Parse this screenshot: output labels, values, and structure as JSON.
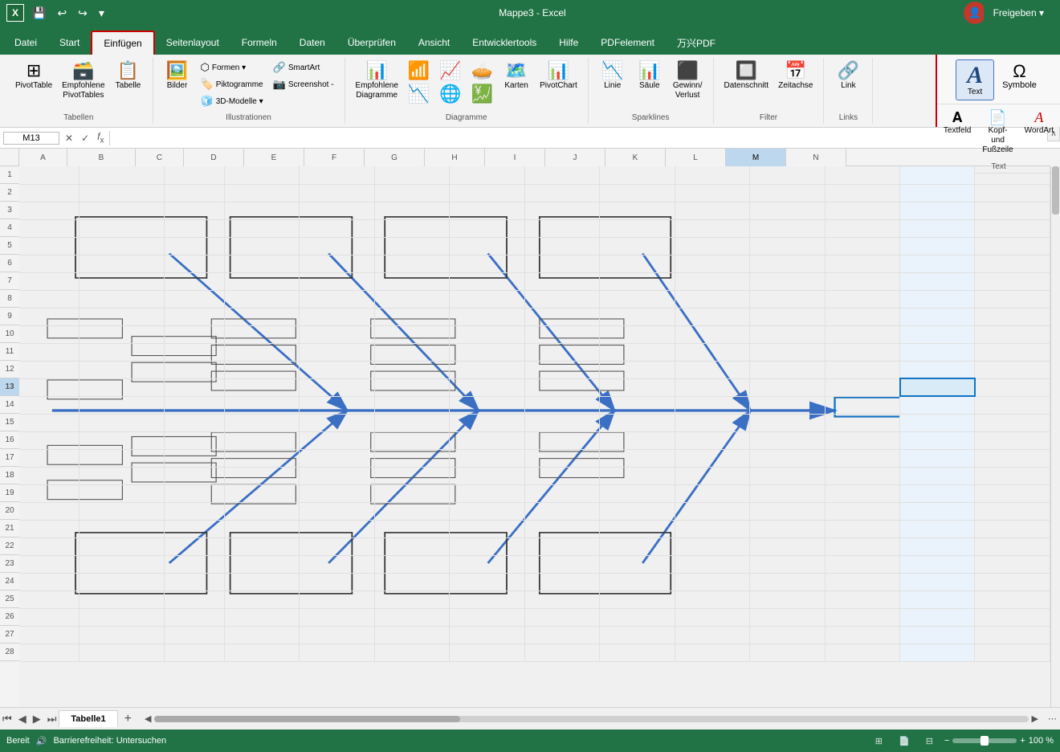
{
  "titlebar": {
    "app": "Mappe3 - Excel",
    "save_icon": "💾",
    "undo_icon": "↩",
    "redo_icon": "↪",
    "minimize": "─",
    "maximize": "□",
    "close": "✕",
    "user_initial": "👤"
  },
  "tabs": {
    "items": [
      "Datei",
      "Start",
      "Einfügen",
      "Seitenlayout",
      "Formeln",
      "Daten",
      "Überprüfen",
      "Ansicht",
      "Entwicklertools",
      "Hilfe",
      "PDFelement",
      "万兴PDF"
    ]
  },
  "freigeben": "Freigeben ▾",
  "ribbon": {
    "tabellen_label": "Tabellen",
    "pivot_label": "PivotTable",
    "empfohlene_label": "Empfohlene\nPivotTables",
    "tabelle_label": "Tabelle",
    "illustrationen_label": "Illustrationen",
    "bilder_label": "Bilder",
    "formen_label": "Formen ▾",
    "piktogramme_label": "Piktogramme",
    "dreid_label": "3D-Modelle ▾",
    "smartart_label": "SmartArt",
    "screenshot_label": "Screenshot -",
    "diagramme_label": "Diagramme",
    "empf_diag_label": "Empfohlene\nDiagramme",
    "karten_label": "Karten",
    "pivotchart_label": "PivotChart",
    "linie_label": "Linie",
    "saeule_label": "Säule",
    "gewinn_label": "Gewinn/\nVerlust",
    "sparklines_label": "Sparklines",
    "datenschnitt_label": "Datenschnitt",
    "zeitachse_label": "Zeitachse",
    "filter_label": "Filter",
    "link_label": "Link",
    "links_label": "Links",
    "text_label": "Text",
    "textfeld_label": "Textfeld",
    "kopf_label": "Kopf- und\nFußzeile",
    "wordart_label": "WordArt",
    "symbole_label": "Symbole",
    "text_section": "Text"
  },
  "namebox": "M13",
  "formula": "",
  "columns": [
    "A",
    "B",
    "C",
    "D",
    "E",
    "F",
    "G",
    "H",
    "I",
    "J",
    "K",
    "L",
    "M",
    "N"
  ],
  "active_col": "M",
  "rows": [
    1,
    2,
    3,
    4,
    5,
    6,
    7,
    8,
    9,
    10,
    11,
    12,
    13,
    14,
    15,
    16,
    17,
    18,
    19,
    20,
    21,
    22,
    23,
    24,
    25,
    26,
    27,
    28
  ],
  "active_row": 13,
  "statusbar": {
    "ready": "Bereit",
    "accessibility": "🔊 Barrierefreiheit: Untersuchen",
    "view_normal": "⊞",
    "view_page": "📄",
    "view_custom": "⊟",
    "zoom_pct": "100 %",
    "zoom_minus": "−",
    "zoom_plus": "+"
  },
  "sheet_tabs": [
    "Tabelle1"
  ],
  "text_panel_title": "Text"
}
